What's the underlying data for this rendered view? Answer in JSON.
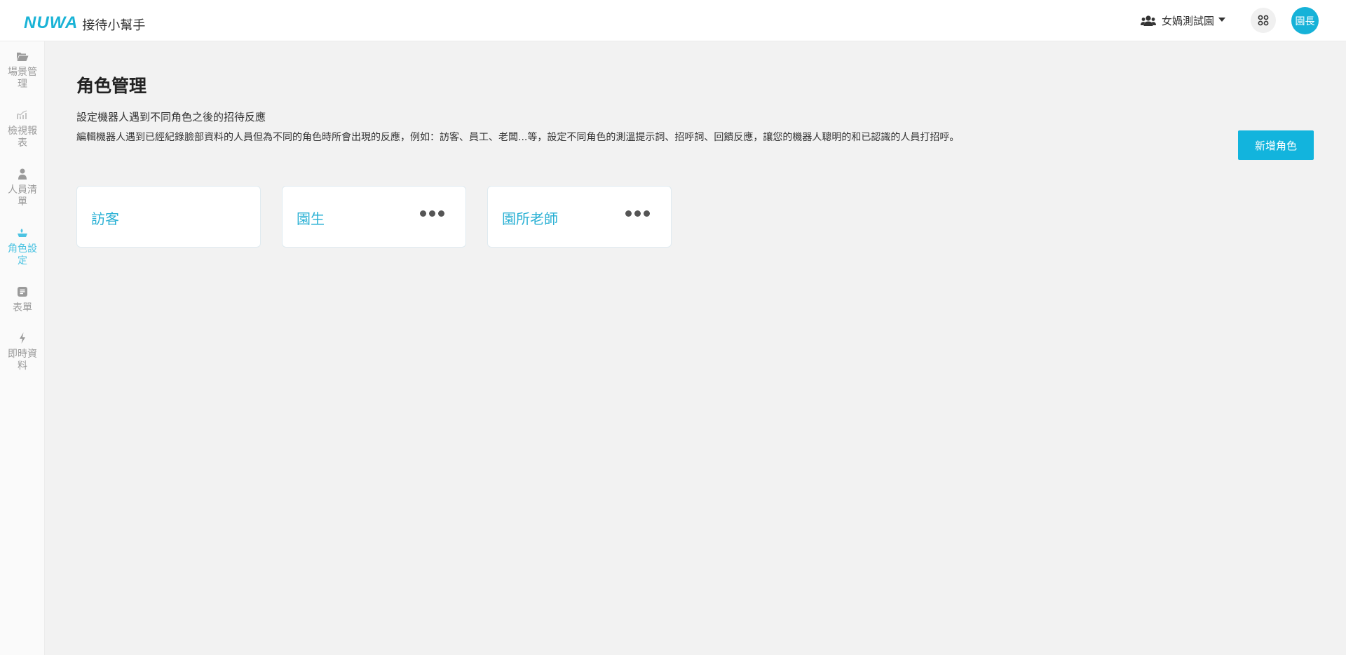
{
  "header": {
    "logo_mark": "NUWA",
    "app_title": "接待小幫手",
    "org_name": "女媧測試園",
    "avatar_label": "園長"
  },
  "sidebar": {
    "items": [
      {
        "label": "場景管理",
        "icon": "folder-open-icon",
        "active": false
      },
      {
        "label": "檢視報表",
        "icon": "chart-trend-icon",
        "active": false
      },
      {
        "label": "人員清單",
        "icon": "person-icon",
        "active": false
      },
      {
        "label": "角色設定",
        "icon": "role-icon",
        "active": true
      },
      {
        "label": "表單",
        "icon": "form-icon",
        "active": false
      },
      {
        "label": "即時資料",
        "icon": "bolt-icon",
        "active": false
      }
    ]
  },
  "main": {
    "title": "角色管理",
    "subtitle": "設定機器人遇到不同角色之後的招待反應",
    "description": "編輯機器人遇到已經紀錄臉部資料的人員但為不同的角色時所會出現的反應，例如：訪客、員工、老闆...等，設定不同角色的測溫提示詞、招呼詞、回饋反應，讓您的機器人聰明的和已認識的人員打招呼。",
    "add_button": "新增角色",
    "roles": [
      {
        "name": "訪客",
        "has_menu": false
      },
      {
        "name": "園生",
        "has_menu": true
      },
      {
        "name": "園所老師",
        "has_menu": true
      }
    ]
  },
  "colors": {
    "accent": "#12b4dd",
    "card_text": "#29b0d4",
    "sidebar_active": "#4cc3e2"
  }
}
